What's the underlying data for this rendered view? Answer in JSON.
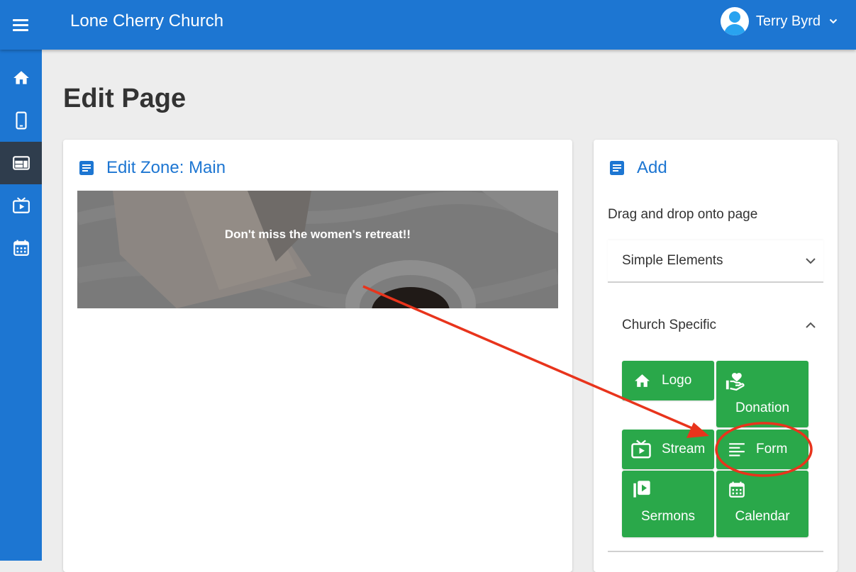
{
  "header": {
    "app_title": "Lone Cherry Church",
    "user_name": "Terry Byrd"
  },
  "sidebar": {
    "items": [
      {
        "icon": "home-icon"
      },
      {
        "icon": "mobile-icon"
      },
      {
        "icon": "web-layout-icon",
        "active": true
      },
      {
        "icon": "live-tv-icon"
      },
      {
        "icon": "calendar-icon"
      }
    ]
  },
  "page": {
    "title": "Edit Page"
  },
  "edit_zone": {
    "title": "Edit Zone: Main",
    "banner_text": "Don't miss the women's retreat!!"
  },
  "add_panel": {
    "title": "Add",
    "subtitle": "Drag and drop onto page",
    "sections": {
      "simple": "Simple Elements",
      "church": "Church Specific"
    },
    "tiles": {
      "logo": "Logo",
      "donation": "Donation",
      "stream": "Stream",
      "form": "Form",
      "sermons": "Sermons",
      "calendar": "Calendar"
    }
  },
  "colors": {
    "primary": "#1d76d2",
    "sidebar_active": "#2f3d4d",
    "tile_green": "#2aa84a",
    "annotation_red": "#e8341c"
  }
}
